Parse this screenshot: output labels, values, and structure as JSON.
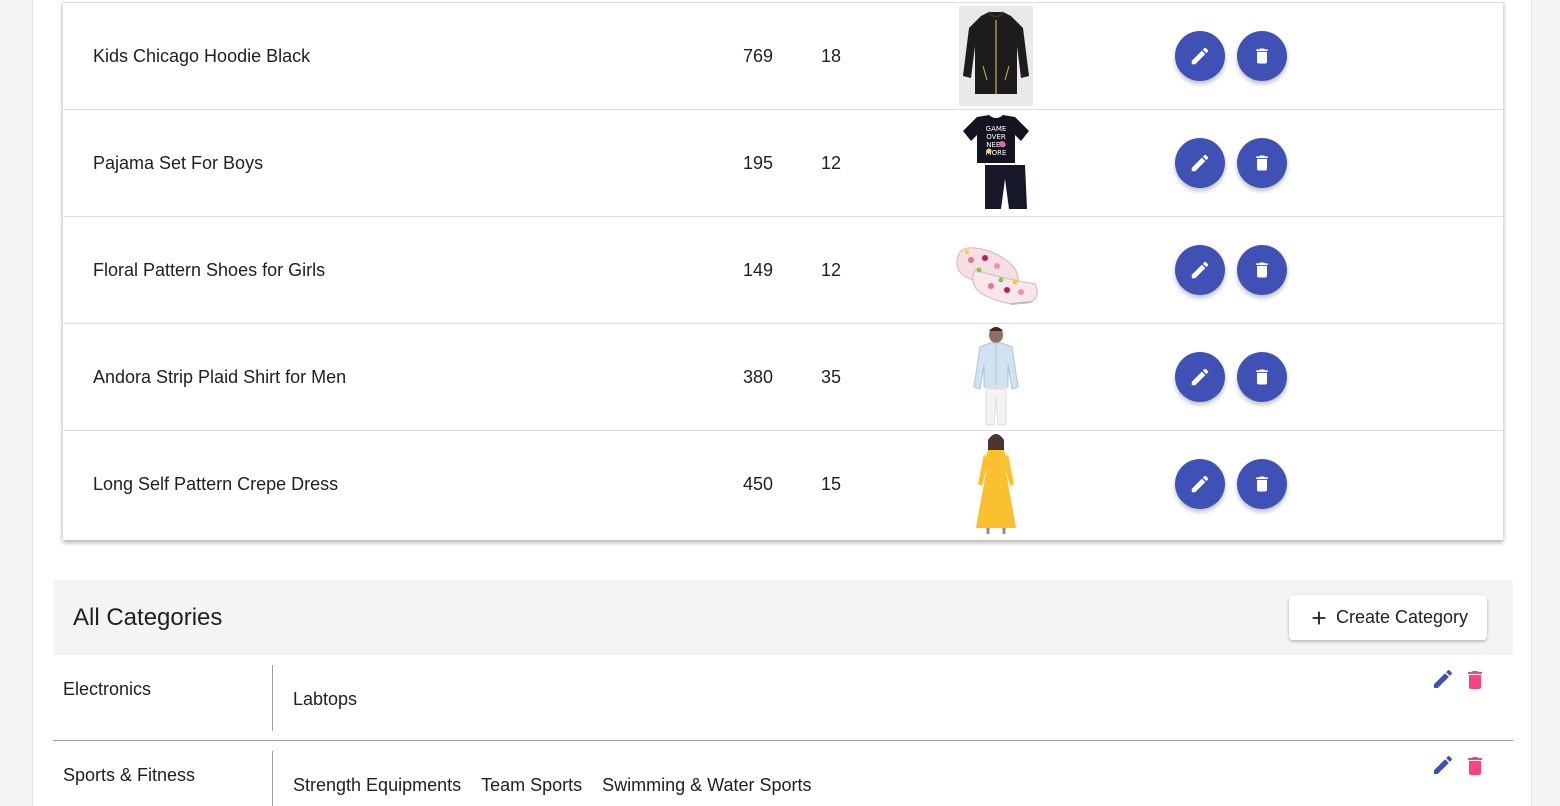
{
  "products": [
    {
      "name": "Kids Chicago Hoodie Black",
      "price": "769",
      "quantity": "18",
      "image": "black-hoodie"
    },
    {
      "name": "Pajama Set For Boys",
      "price": "195",
      "quantity": "12",
      "image": "pajama-set"
    },
    {
      "name": "Floral Pattern Shoes for Girls",
      "price": "149",
      "quantity": "12",
      "image": "floral-shoes"
    },
    {
      "name": "Andora Strip Plaid Shirt for Men",
      "price": "380",
      "quantity": "35",
      "image": "blue-shirt"
    },
    {
      "name": "Long Self Pattern Crepe Dress",
      "price": "450",
      "quantity": "15",
      "image": "yellow-dress"
    }
  ],
  "product_actions": {
    "edit_icon": "pencil-icon",
    "delete_icon": "trash-icon",
    "color": "#3f51b5"
  },
  "categories_section": {
    "title": "All Categories",
    "create_button_label": "Create Category",
    "create_icon": "plus-icon"
  },
  "categories": [
    {
      "name": "Electronics",
      "subcategories": [
        "Labtops"
      ]
    },
    {
      "name": "Sports & Fitness",
      "subcategories": [
        "Strength Equipments",
        "Team Sports",
        "Swimming & Water Sports"
      ]
    }
  ],
  "colors": {
    "primary": "#3f51b5",
    "delete_accent": "#ff4081"
  }
}
